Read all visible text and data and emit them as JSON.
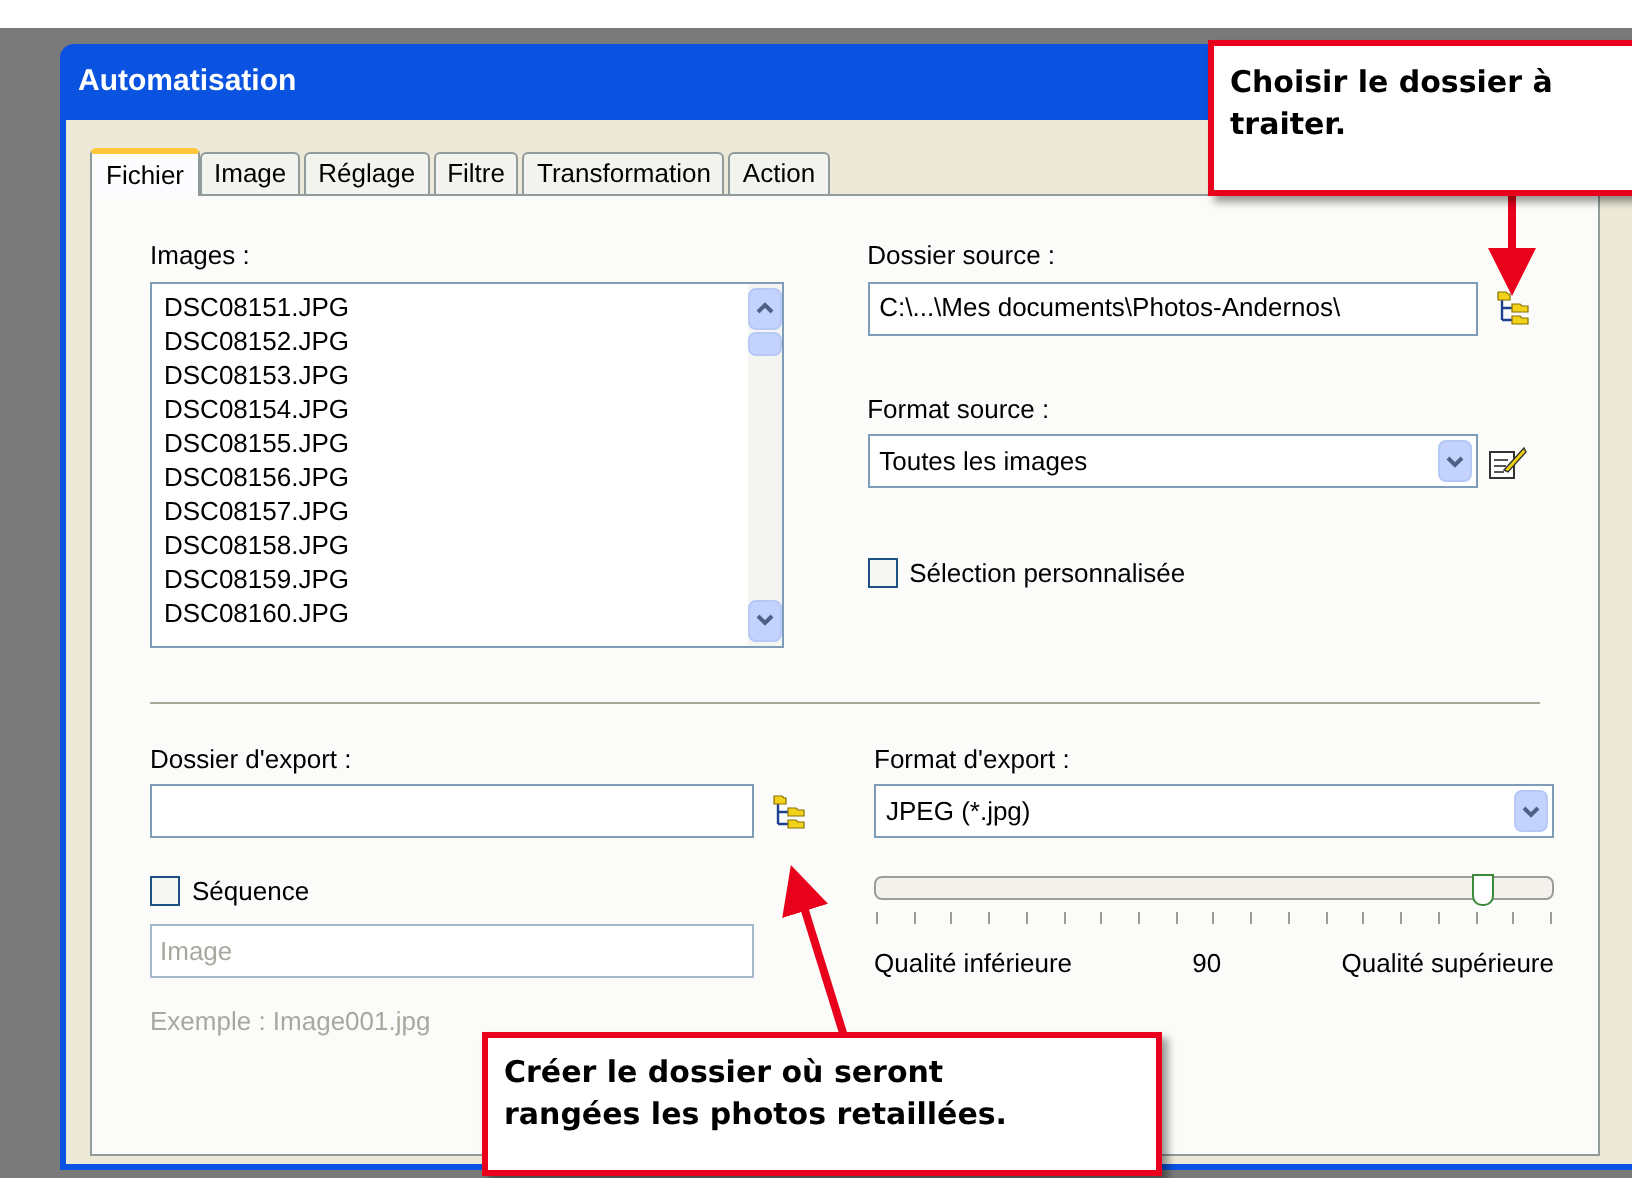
{
  "window": {
    "title": "Automatisation"
  },
  "tabs": [
    {
      "label": "Fichier",
      "selected": true
    },
    {
      "label": "Image",
      "selected": false
    },
    {
      "label": "Réglage",
      "selected": false
    },
    {
      "label": "Filtre",
      "selected": false
    },
    {
      "label": "Transformation",
      "selected": false
    },
    {
      "label": "Action",
      "selected": false
    }
  ],
  "images": {
    "label": "Images :",
    "items": [
      "DSC08151.JPG",
      "DSC08152.JPG",
      "DSC08153.JPG",
      "DSC08154.JPG",
      "DSC08155.JPG",
      "DSC08156.JPG",
      "DSC08157.JPG",
      "DSC08158.JPG",
      "DSC08159.JPG",
      "DSC08160.JPG"
    ]
  },
  "source_folder": {
    "label": "Dossier source :",
    "value": "C:\\...\\Mes documents\\Photos-Andernos\\"
  },
  "source_format": {
    "label": "Format source :",
    "value": "Toutes les images"
  },
  "custom_selection": {
    "label": "Sélection personnalisée",
    "checked": false
  },
  "export_folder": {
    "label": "Dossier d'export :"
  },
  "sequence": {
    "label": "Séquence",
    "checked": false,
    "placeholder": "Image",
    "example": "Exemple : Image001.jpg"
  },
  "export_format": {
    "label": "Format d'export :",
    "value": "JPEG (*.jpg)"
  },
  "quality": {
    "level": 0.9,
    "min_label": "Qualité inférieure",
    "reading": "90",
    "max_label": "Qualité supérieure"
  },
  "callouts": [
    {
      "text": "Choisir le dossier à traiter."
    },
    {
      "text": "Créer le dossier où seront rangées les photos retaillées."
    }
  ]
}
